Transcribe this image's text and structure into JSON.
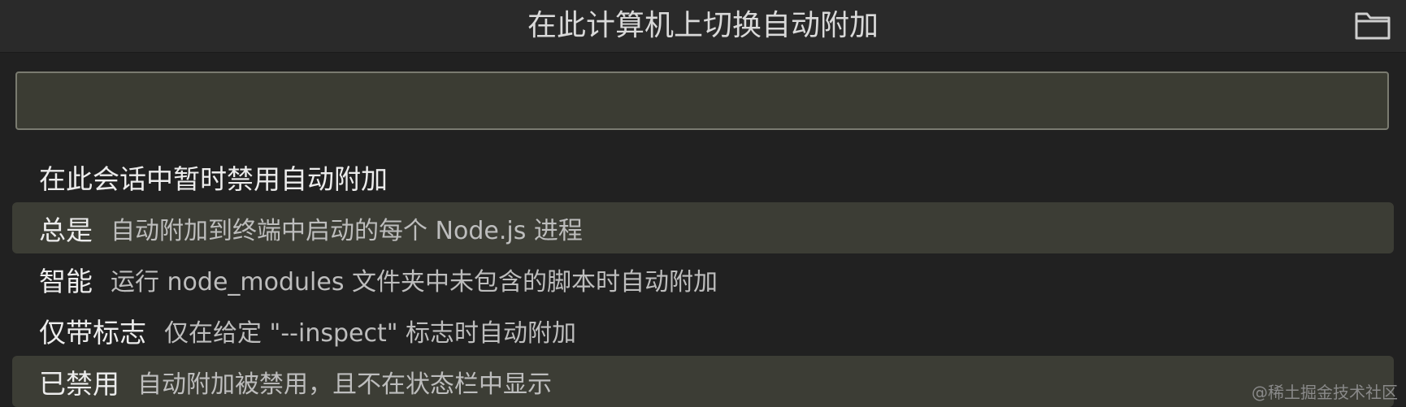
{
  "header": {
    "title": "在此计算机上切换自动附加",
    "folder_icon": "folder-icon"
  },
  "search": {
    "value": "",
    "placeholder": ""
  },
  "items": [
    {
      "label": "在此会话中暂时禁用自动附加",
      "description": ""
    },
    {
      "label": "总是",
      "description": "自动附加到终端中启动的每个 Node.js 进程"
    },
    {
      "label": "智能",
      "description": "运行 node_modules 文件夹中未包含的脚本时自动附加"
    },
    {
      "label": "仅带标志",
      "description": "仅在给定 \"--inspect\" 标志时自动附加"
    },
    {
      "label": "已禁用",
      "description": "自动附加被禁用，且不在状态栏中显示"
    }
  ],
  "watermark": "@稀土掘金技术社区",
  "colors": {
    "background": "#212121",
    "header": "#2a2a2a",
    "highlight": "#3c3d35",
    "search_bg": "#3b3c33",
    "search_border": "#7a7b70"
  }
}
